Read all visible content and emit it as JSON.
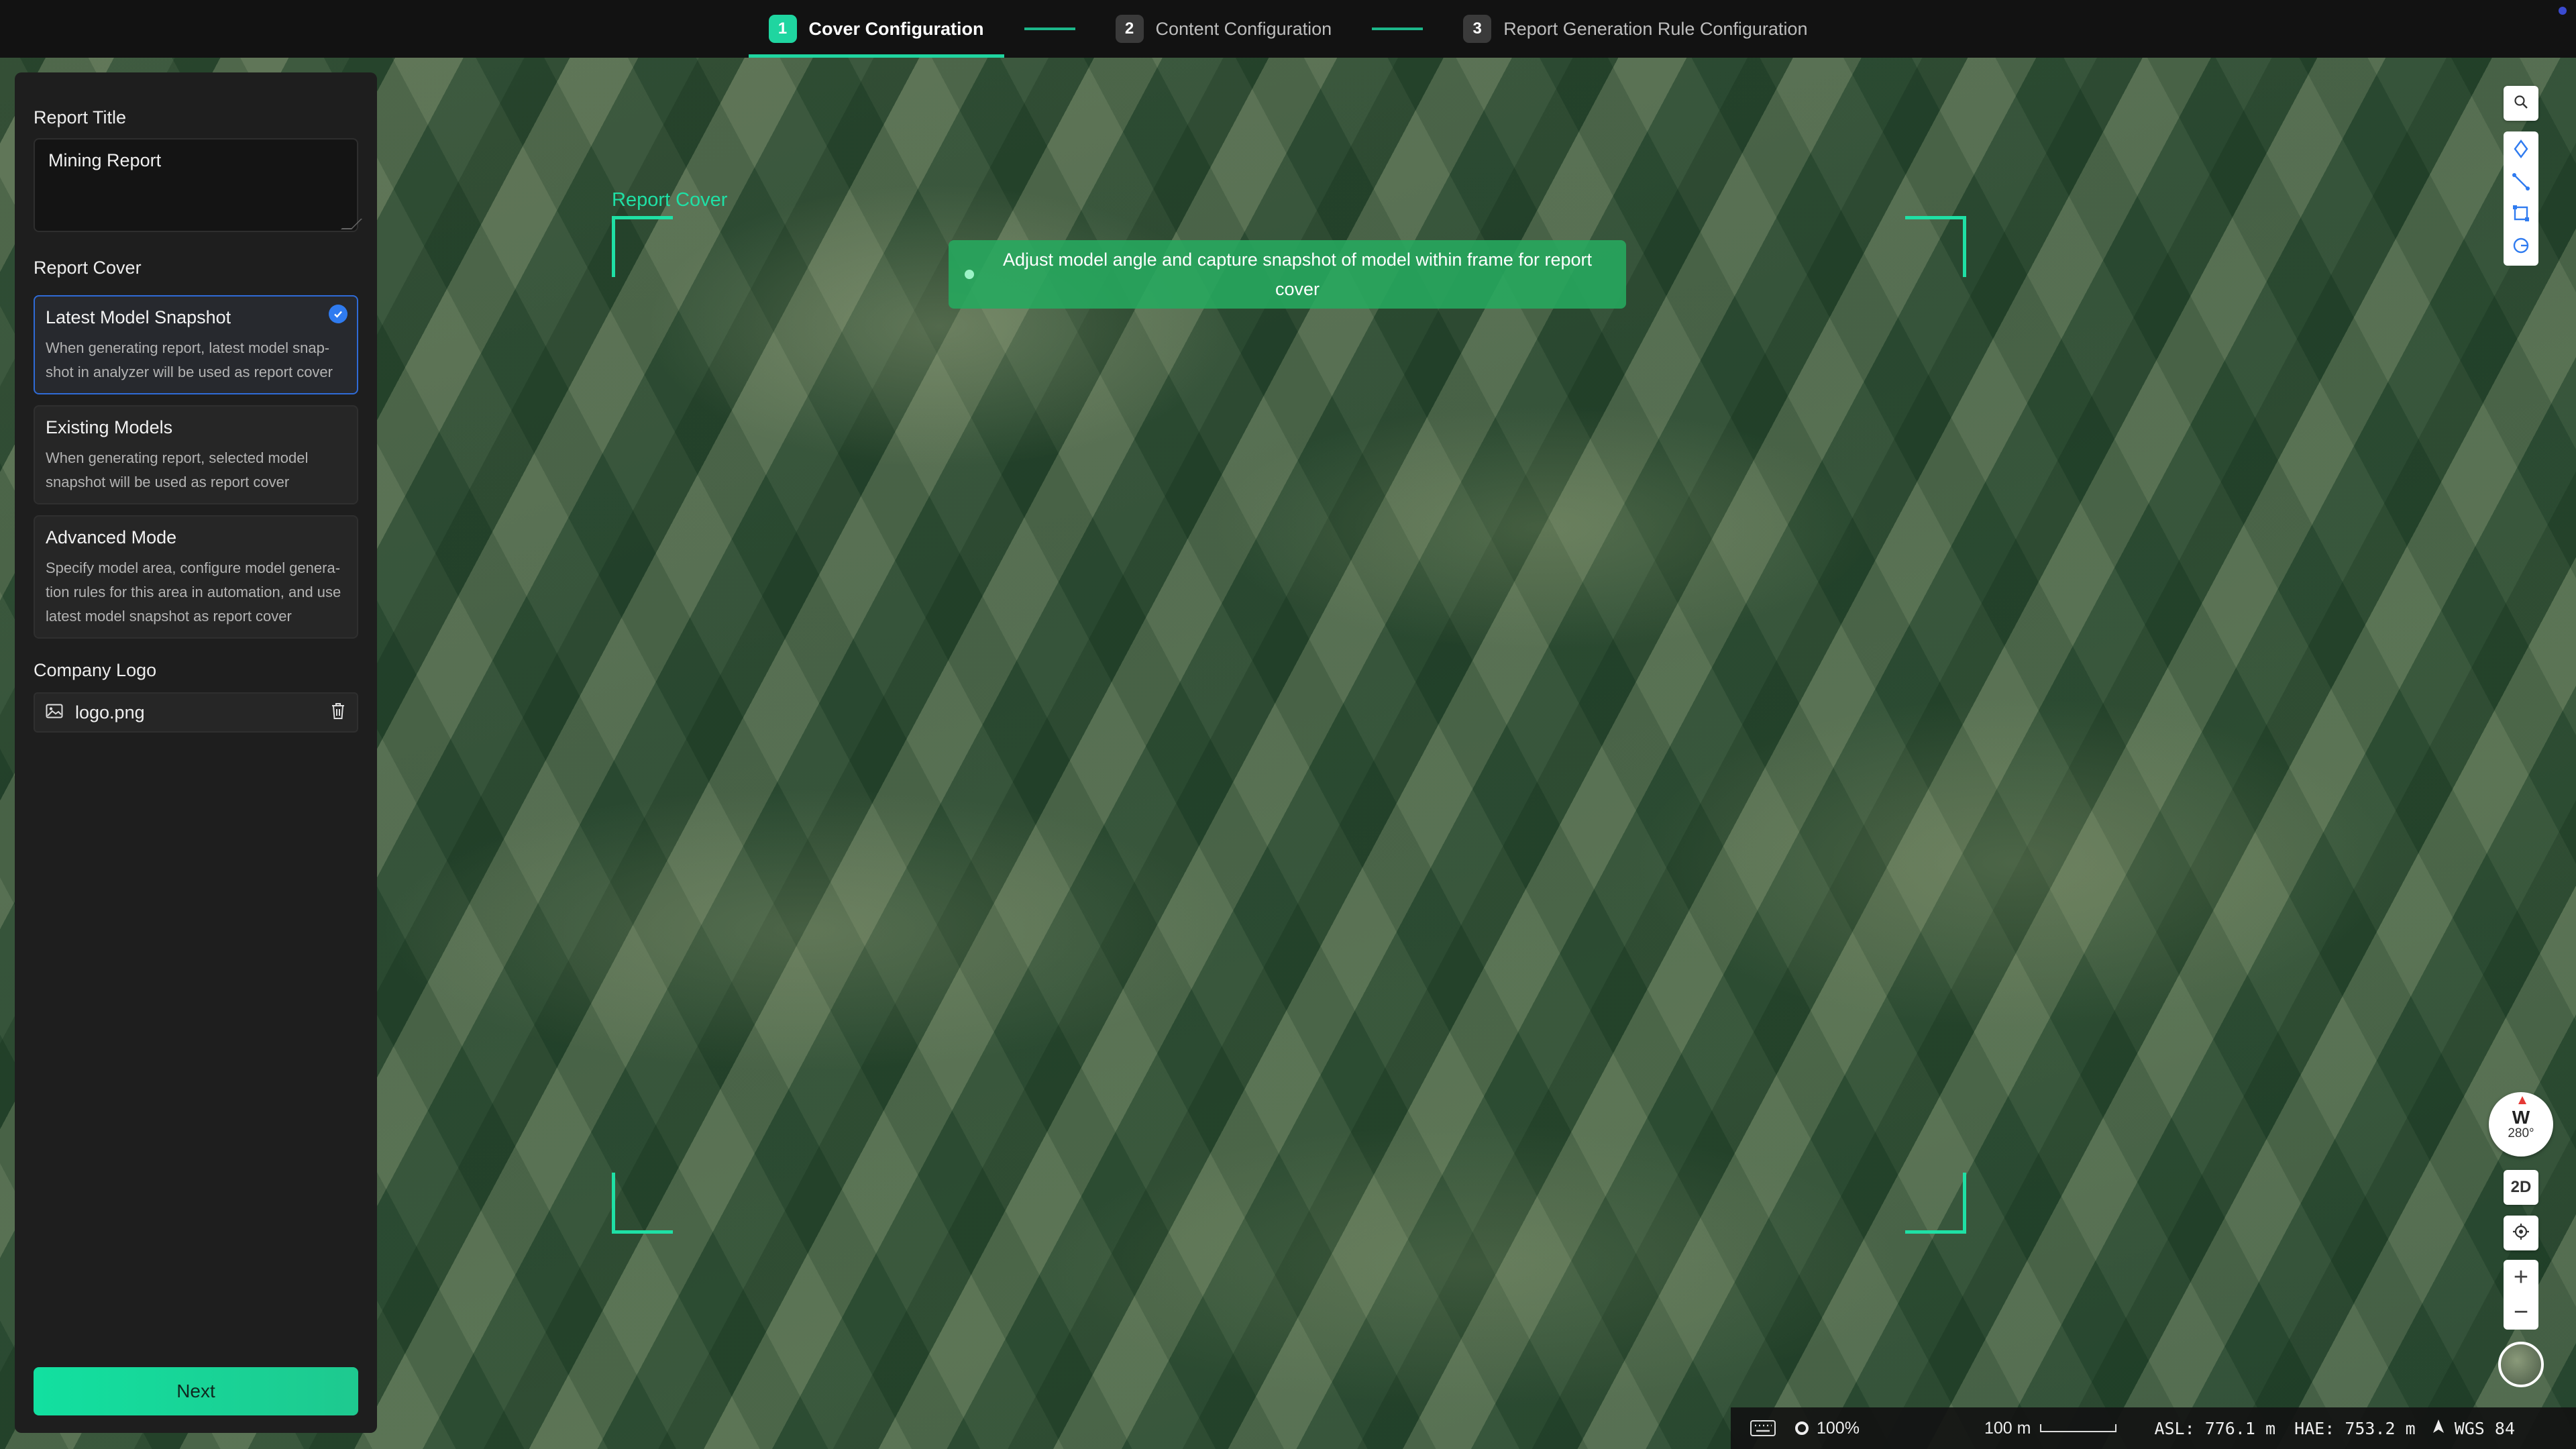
{
  "stepper": {
    "steps": [
      {
        "num": "1",
        "label": "Cover Configuration",
        "active": true
      },
      {
        "num": "2",
        "label": "Content Configuration",
        "active": false
      },
      {
        "num": "3",
        "label": "Report Generation Rule Configuration",
        "active": false
      }
    ],
    "accent": "#1fd5a0"
  },
  "panel": {
    "report_title_label": "Report Title",
    "report_title_value": "Mining Report",
    "report_cover_label": "Report Cover",
    "options": [
      {
        "title": "Latest Model Snapshot",
        "desc": "When generating report, latest model snap-shot in analyzer will be used as report cover",
        "selected": true
      },
      {
        "title": "Existing Models",
        "desc": "When generating report, selected model snapshot will be used as report cover",
        "selected": false
      },
      {
        "title": "Advanced Mode",
        "desc": "Specify model area, configure model genera-tion rules for this area in automation, and use latest model snapshot as report cover",
        "selected": false
      }
    ],
    "company_logo_label": "Company Logo",
    "logo_file": "logo.png",
    "next_label": "Next"
  },
  "viewer": {
    "frame_label": "Report Cover",
    "hint": "Adjust model angle and capture snapshot of model within frame for report cover",
    "compass": {
      "dir": "W",
      "deg": "280°"
    },
    "view_mode": "2D",
    "zoom_in": "+",
    "zoom_out": "−"
  },
  "statusbar": {
    "zoom": "100%",
    "scale": "100 m",
    "asl": "ASL: 776.1 m",
    "hae": "HAE: 753.2 m",
    "crs": "WGS 84"
  },
  "icons": {
    "search": "search-icon",
    "point": "point-icon",
    "line": "line-icon",
    "polygon": "polygon-icon",
    "circle": "circle-measure-icon",
    "locate": "locate-icon",
    "image": "image-icon",
    "trash": "trash-icon",
    "keyboard": "keyboard-icon"
  }
}
